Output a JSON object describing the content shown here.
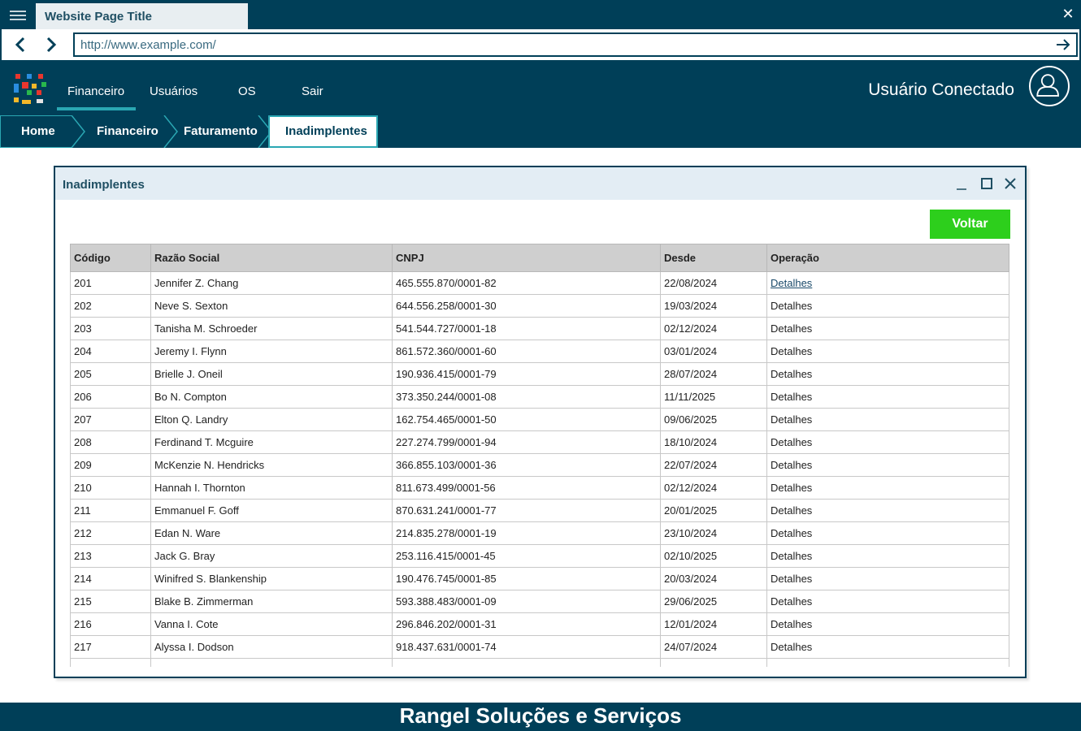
{
  "browser": {
    "tab_title": "Website Page Title",
    "url": "http://www.example.com/"
  },
  "app": {
    "nav": [
      {
        "label": "Financeiro",
        "active": true
      },
      {
        "label": "Usuários",
        "active": false
      },
      {
        "label": "OS",
        "active": false
      },
      {
        "label": "Sair",
        "active": false
      }
    ],
    "user_label": "Usuário Conectado",
    "breadcrumb": [
      "Home",
      "Financeiro",
      "Faturamento",
      "Inadimplentes"
    ]
  },
  "dialog": {
    "title": "Inadimplentes",
    "back_button": "Voltar",
    "columns": [
      "Código",
      "Razão Social",
      "CNPJ",
      "Desde",
      "Operação"
    ],
    "rows": [
      [
        "201",
        "Jennifer Z. Chang",
        "465.555.870/0001-82",
        "22/08/2024",
        "Detalhes"
      ],
      [
        "202",
        "Neve S. Sexton",
        "644.556.258/0001-30",
        "19/03/2024",
        "Detalhes"
      ],
      [
        "203",
        "Tanisha M. Schroeder",
        "541.544.727/0001-18",
        "02/12/2024",
        "Detalhes"
      ],
      [
        "204",
        "Jeremy I. Flynn",
        "861.572.360/0001-60",
        "03/01/2024",
        "Detalhes"
      ],
      [
        "205",
        "Brielle J. Oneil",
        "190.936.415/0001-79",
        "28/07/2024",
        "Detalhes"
      ],
      [
        "206",
        "Bo N. Compton",
        "373.350.244/0001-08",
        "11/11/2025",
        "Detalhes"
      ],
      [
        "207",
        "Elton Q. Landry",
        "162.754.465/0001-50",
        "09/06/2025",
        "Detalhes"
      ],
      [
        "208",
        "Ferdinand T. Mcguire",
        "227.274.799/0001-94",
        "18/10/2024",
        "Detalhes"
      ],
      [
        "209",
        "McKenzie N. Hendricks",
        "366.855.103/0001-36",
        "22/07/2024",
        "Detalhes"
      ],
      [
        "210",
        "Hannah I. Thornton",
        "811.673.499/0001-56",
        "02/12/2024",
        "Detalhes"
      ],
      [
        "211",
        "Emmanuel F. Goff",
        "870.631.241/0001-77",
        "20/01/2025",
        "Detalhes"
      ],
      [
        "212",
        "Edan N. Ware",
        "214.835.278/0001-19",
        "23/10/2024",
        "Detalhes"
      ],
      [
        "213",
        "Jack G. Bray",
        "253.116.415/0001-45",
        "02/10/2025",
        "Detalhes"
      ],
      [
        "214",
        "Winifred S. Blankenship",
        "190.476.745/0001-85",
        "20/03/2024",
        "Detalhes"
      ],
      [
        "215",
        "Blake B. Zimmerman",
        "593.388.483/0001-09",
        "29/06/2025",
        "Detalhes"
      ],
      [
        "216",
        "Vanna I. Cote",
        "296.846.202/0001-31",
        "12/01/2024",
        "Detalhes"
      ],
      [
        "217",
        "Alyssa I. Dodson",
        "918.437.631/0001-74",
        "24/07/2024",
        "Detalhes"
      ],
      [
        "",
        "",
        "",
        "",
        ""
      ]
    ]
  },
  "footer": {
    "text": "Rangel Soluções e Serviços"
  },
  "colors": {
    "primary": "#003f58",
    "accent": "#2aa7b3",
    "success": "#2dcf1c",
    "dialog_header": "#e3edf4",
    "table_header": "#cfcfcf"
  }
}
